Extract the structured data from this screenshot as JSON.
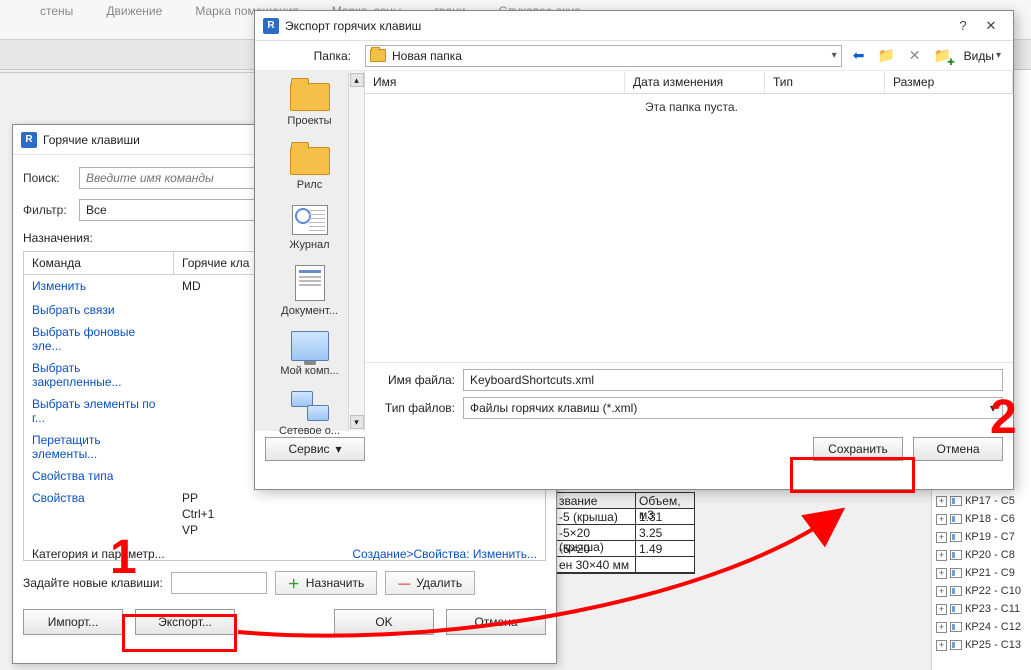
{
  "ribbon": {
    "items": [
      "стены",
      "Движение",
      "Марка помещения",
      "Марка, зоны",
      "грани",
      "Слуховое окно"
    ]
  },
  "hotkeys_dialog": {
    "title": "Горячие клавиши",
    "search_label": "Поиск:",
    "search_placeholder": "Введите имя команды",
    "filter_label": "Фильтр:",
    "filter_value": "Все",
    "assignments_label": "Назначения:",
    "col_command": "Команда",
    "col_key": "Горячие кла",
    "rows": [
      {
        "cmd": "Изменить",
        "keys": [
          "MD"
        ]
      },
      {
        "cmd": "Выбрать связи",
        "keys": []
      },
      {
        "cmd": "Выбрать фоновые эле...",
        "keys": []
      },
      {
        "cmd": "Выбрать закрепленные...",
        "keys": []
      },
      {
        "cmd": "Выбрать элементы по г...",
        "keys": []
      },
      {
        "cmd": "Перетащить элементы...",
        "keys": []
      },
      {
        "cmd": "Свойства типа",
        "keys": []
      },
      {
        "cmd": "Свойства",
        "keys": [
          "PP",
          "Ctrl+1",
          "VP"
        ]
      }
    ],
    "path_left": "Категория и параметр...",
    "path_right": "Создание>Свойства: Изменить...",
    "new_keys_label": "Задайте новые клавиши:",
    "assign_btn": "Назначить",
    "remove_btn": "Удалить",
    "import_btn": "Импорт...",
    "export_btn": "Экспорт...",
    "ok_btn": "OK",
    "cancel_btn": "Отмена"
  },
  "export_dialog": {
    "title": "Экспорт горячих клавиш",
    "folder_label": "Папка:",
    "folder_value": "Новая папка",
    "views_label": "Виды",
    "places": [
      {
        "type": "folder",
        "label": "Проекты"
      },
      {
        "type": "folder",
        "label": "Рилс"
      },
      {
        "type": "journ",
        "label": "Журнал"
      },
      {
        "type": "doc",
        "label": "Документ..."
      },
      {
        "type": "comp",
        "label": "Мой комп..."
      },
      {
        "type": "net",
        "label": "Сетевое о..."
      }
    ],
    "col_name": "Имя",
    "col_date": "Дата изменения",
    "col_type": "Тип",
    "col_size": "Размер",
    "empty_msg": "Эта папка пуста.",
    "filename_label": "Имя файла:",
    "filename_value": "KeyboardShortcuts.xml",
    "filetype_label": "Тип файлов:",
    "filetype_value": "Файлы горячих клавиш  (*.xml)",
    "service_btn": "Сервис",
    "save_btn": "Сохранить",
    "cancel_btn": "Отмена"
  },
  "annotations": {
    "num1": "1",
    "num2": "2"
  },
  "bg_table": {
    "header": [
      "звание",
      "Объем, м3"
    ],
    "rows": [
      [
        "-5 (крыша)",
        "1.31"
      ],
      [
        "-5×20 (крыша)",
        "3.25"
      ],
      [
        "-5×20",
        "1.49"
      ],
      [
        "ен 30×40 мм",
        ""
      ]
    ]
  },
  "tree": {
    "items": [
      "КР17 - C5",
      "КР18 - C6",
      "КР19 - C7",
      "КР20 - C8",
      "КР21 - C9",
      "КР22 - C10",
      "КР23 - C11",
      "КР24 - C12",
      "КР25 - C13"
    ]
  }
}
